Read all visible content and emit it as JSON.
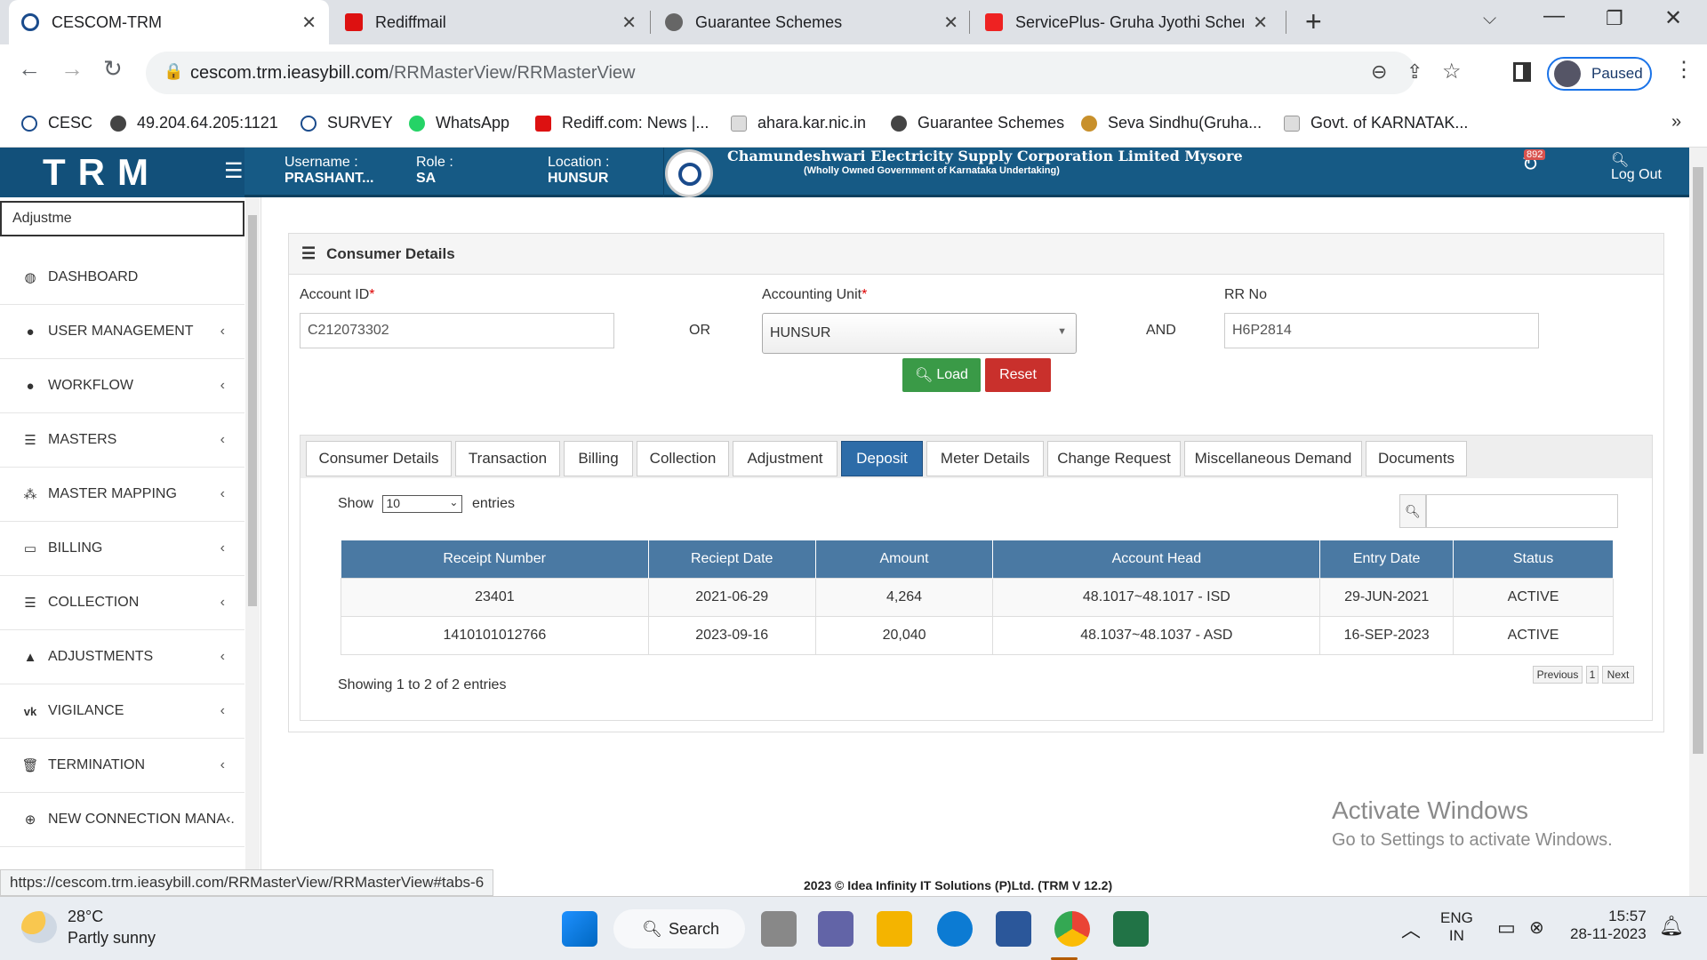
{
  "browser": {
    "tabs": [
      {
        "title": "CESCOM-TRM",
        "active": true
      },
      {
        "title": "Rediffmail",
        "active": false
      },
      {
        "title": "Guarantee Schemes",
        "active": false
      },
      {
        "title": "ServicePlus- Gruha Jyothi Schem",
        "active": false
      }
    ],
    "url_host": "cescom.trm.ieasybill.com",
    "url_path": "/RRMasterView/RRMasterView",
    "profile_label": "Paused",
    "bookmarks": [
      "CESC",
      "49.204.64.205:1121",
      "SURVEY",
      "WhatsApp",
      "Rediff.com: News |...",
      "ahara.kar.nic.in",
      "Guarantee Schemes",
      "Seva Sindhu(Gruha...",
      "Govt. of KARNATAK..."
    ],
    "status_url": "https://cescom.trm.ieasybill.com/RRMasterView/RRMasterView#tabs-6"
  },
  "header": {
    "logo": "TRM",
    "username_label": "Username :",
    "username": "PRASHANT...",
    "role_label": "Role :",
    "role": "SA",
    "location_label": "Location :",
    "location": "HUNSUR",
    "org_name": "Chamundeshwari Electricity Supply Corporation Limited Mysore",
    "org_sub": "(Wholly Owned Government of Karnataka Undertaking)",
    "notification_count": "892",
    "logout": "Log Out"
  },
  "sidebar": {
    "search_value": "Adjustme",
    "items": [
      {
        "label": "DASHBOARD",
        "icon": "dashboard-icon",
        "chevron": false
      },
      {
        "label": "USER MANAGEMENT",
        "icon": "user-icon",
        "chevron": true
      },
      {
        "label": "WORKFLOW",
        "icon": "user-icon",
        "chevron": true
      },
      {
        "label": "MASTERS",
        "icon": "list-icon",
        "chevron": true
      },
      {
        "label": "MASTER MAPPING",
        "icon": "sitemap-icon",
        "chevron": true
      },
      {
        "label": "BILLING",
        "icon": "monitor-icon",
        "chevron": true
      },
      {
        "label": "COLLECTION",
        "icon": "list-icon",
        "chevron": true
      },
      {
        "label": "ADJUSTMENTS",
        "icon": "warning-icon",
        "chevron": true
      },
      {
        "label": "VIGILANCE",
        "icon": "vk-icon",
        "chevron": true
      },
      {
        "label": "TERMINATION",
        "icon": "trash-icon",
        "chevron": true
      },
      {
        "label": "NEW CONNECTION MANA‹.",
        "icon": "plus-circle-icon",
        "chevron": false
      }
    ]
  },
  "consumer": {
    "panel_title": "Consumer Details",
    "account_id_label": "Account ID",
    "account_id": "C212073302",
    "or_label": "OR",
    "accounting_unit_label": "Accounting Unit",
    "accounting_unit": "HUNSUR",
    "and_label": "AND",
    "rr_no_label": "RR No",
    "rr_no": "H6P2814",
    "load_button": "Load",
    "reset_button": "Reset"
  },
  "tabs": [
    "Consumer Details",
    "Transaction",
    "Billing",
    "Collection",
    "Adjustment",
    "Deposit",
    "Meter Details",
    "Change Request",
    "Miscellaneous Demand",
    "Documents"
  ],
  "active_tab": "Deposit",
  "table": {
    "show_label": "Show",
    "entries_value": "10",
    "entries_label": "entries",
    "columns": [
      "Receipt Number",
      "Reciept Date",
      "Amount",
      "Account Head",
      "Entry Date",
      "Status"
    ],
    "rows": [
      [
        "23401",
        "2021-06-29",
        "4,264",
        "48.1017~48.1017 - ISD",
        "29-JUN-2021",
        "ACTIVE"
      ],
      [
        "1410101012766",
        "2023-09-16",
        "20,040",
        "48.1037~48.1037 - ASD",
        "16-SEP-2023",
        "ACTIVE"
      ]
    ],
    "info": "Showing 1 to 2 of 2 entries",
    "prev": "Previous",
    "page": "1",
    "next": "Next"
  },
  "footer": "2023 © Idea Infinity IT Solutions (P)Ltd. (TRM V 12.2)",
  "activate": {
    "line1": "Activate Windows",
    "line2": "Go to Settings to activate Windows."
  },
  "taskbar": {
    "temp": "28°C",
    "weather": "Partly sunny",
    "search": "Search",
    "lang1": "ENG",
    "lang2": "IN",
    "time": "15:57",
    "date": "28-11-2023"
  },
  "colors": {
    "header_blue": "#165a85",
    "tab_active": "#2d6ca8",
    "load_green": "#3a9a47",
    "reset_red": "#c9302c"
  }
}
